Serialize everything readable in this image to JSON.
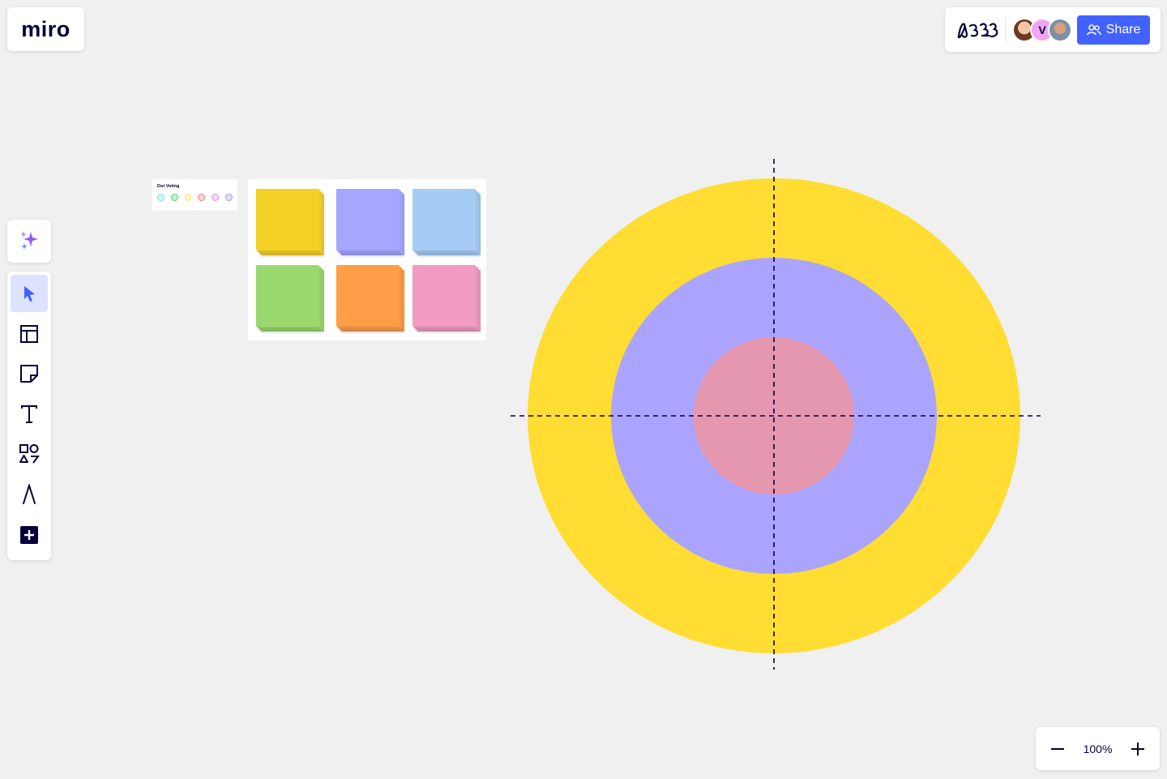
{
  "app": {
    "logo_text": "miro"
  },
  "header": {
    "board_icon": "board-scribble-icon",
    "collaborators": [
      {
        "name": "collaborator-avatar-1",
        "initial": ""
      },
      {
        "name": "collaborator-avatar-2",
        "initial": "V"
      },
      {
        "name": "collaborator-avatar-3",
        "initial": ""
      }
    ],
    "share_label": "Share"
  },
  "toolbar": {
    "ai_icon": "sparkles-icon",
    "tools": [
      {
        "id": "select",
        "icon": "cursor-icon",
        "active": true
      },
      {
        "id": "templates",
        "icon": "templates-icon",
        "active": false
      },
      {
        "id": "sticky-note",
        "icon": "sticky-note-icon",
        "active": false
      },
      {
        "id": "text",
        "icon": "text-icon",
        "active": false
      },
      {
        "id": "shapes",
        "icon": "shapes-icon",
        "active": false
      },
      {
        "id": "pen",
        "icon": "pen-icon",
        "active": false
      },
      {
        "id": "more",
        "icon": "plus-square-icon",
        "active": false
      }
    ]
  },
  "zoom": {
    "value": "100%"
  },
  "board": {
    "dot_voting": {
      "title": "Dot Voting",
      "dot_colors": [
        "#6fe3e8",
        "#57d36b",
        "#f5e663",
        "#f27a8a",
        "#f08ae6",
        "#a89bf5"
      ]
    },
    "sticky_colors": [
      "#f5d128",
      "#a6a6ff",
      "#a6ccf5",
      "#9bd86f",
      "#ff9d48",
      "#f29bc2"
    ],
    "target": {
      "outer_color": "#ffdd33",
      "middle_color": "#aba4ff",
      "inner_color": "#e597b0",
      "axis_color": "#050038"
    }
  }
}
